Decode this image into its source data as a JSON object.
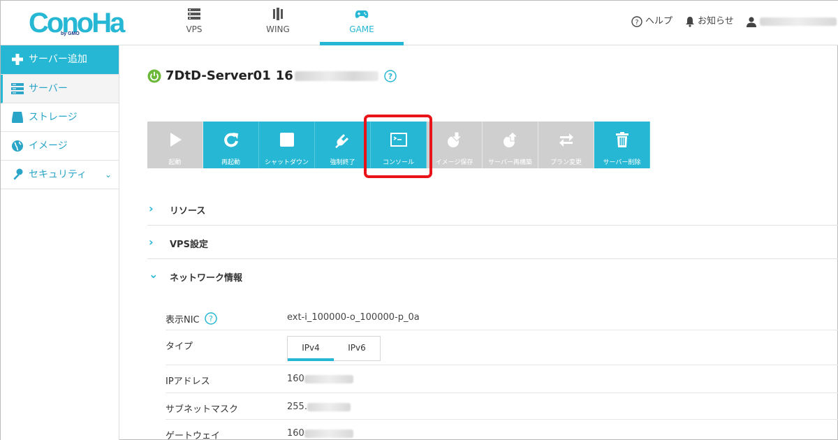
{
  "brand": {
    "logo_text": "ConoHa",
    "logo_sub": "by GMO",
    "accent": "#25b7d3",
    "alert": "#e8141a"
  },
  "nav": {
    "tabs": [
      {
        "label": "VPS",
        "icon": "server-icon"
      },
      {
        "label": "WING",
        "icon": "wing-icon"
      },
      {
        "label": "GAME",
        "icon": "gamepad-icon",
        "active": true
      }
    ]
  },
  "header": {
    "help": "ヘルプ",
    "notice": "お知らせ"
  },
  "sidebar": {
    "items": [
      {
        "label": "サーバー追加",
        "icon": "plus-icon"
      },
      {
        "label": "サーバー",
        "icon": "server-list-icon"
      },
      {
        "label": "ストレージ",
        "icon": "storage-icon"
      },
      {
        "label": "イメージ",
        "icon": "globe-icon"
      },
      {
        "label": "セキュリティ",
        "icon": "key-icon"
      }
    ]
  },
  "server": {
    "name": "7DtD-Server01",
    "ip_prefix": "16"
  },
  "toolbar": {
    "buttons": [
      {
        "label": "起動",
        "icon": "play-icon",
        "enabled": false
      },
      {
        "label": "再起動",
        "icon": "restart-icon",
        "enabled": true
      },
      {
        "label": "シャットダウン",
        "icon": "stop-icon",
        "enabled": true
      },
      {
        "label": "強制終了",
        "icon": "plug-icon",
        "enabled": true
      },
      {
        "label": "コンソール",
        "icon": "console-icon",
        "enabled": true
      },
      {
        "label": "イメージ保存",
        "icon": "image-save-icon",
        "enabled": false
      },
      {
        "label": "サーバー再構築",
        "icon": "rebuild-icon",
        "enabled": false
      },
      {
        "label": "プラン変更",
        "icon": "swap-icon",
        "enabled": false
      },
      {
        "label": "サーバー削除",
        "icon": "trash-icon",
        "enabled": true
      }
    ]
  },
  "sections": [
    {
      "label": "リソース",
      "expanded": false
    },
    {
      "label": "VPS設定",
      "expanded": false
    },
    {
      "label": "ネットワーク情報",
      "expanded": true
    }
  ],
  "network": {
    "nic_label": "表示NIC",
    "nic_value": "ext-i_100000-o_100000-p_0a",
    "type_label": "タイプ",
    "type_options": [
      "IPv4",
      "IPv6"
    ],
    "type_selected": "IPv4",
    "ip_label": "IPアドレス",
    "ip_value": "160",
    "subnet_label": "サブネットマスク",
    "subnet_value": "255.",
    "gateway_label": "ゲートウェイ",
    "gateway_value": "160"
  }
}
